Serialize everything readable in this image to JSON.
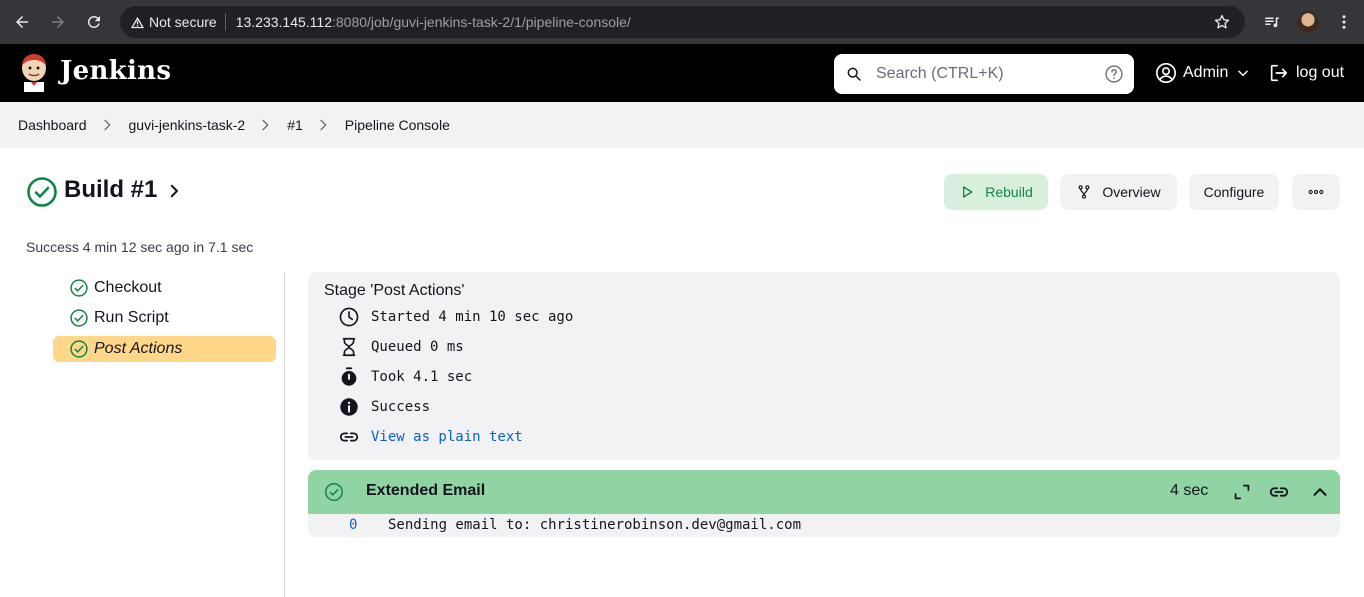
{
  "browser": {
    "security_label": "Not secure",
    "url_host": "13.233.145.112",
    "url_rest": ":8080/job/guvi-jenkins-task-2/1/pipeline-console/"
  },
  "header": {
    "brand": "Jenkins",
    "search_placeholder": "Search (CTRL+K)",
    "user_name": "Admin",
    "logout_label": "log out"
  },
  "breadcrumb": [
    "Dashboard",
    "guvi-jenkins-task-2",
    "#1",
    "Pipeline Console"
  ],
  "build": {
    "title": "Build #1",
    "summary": "Success 4 min 12 sec ago in 7.1 sec",
    "actions": {
      "rebuild": "Rebuild",
      "overview": "Overview",
      "configure": "Configure"
    }
  },
  "stages": [
    {
      "label": "Checkout",
      "status": "success"
    },
    {
      "label": "Run Script",
      "status": "success"
    },
    {
      "label": "Post Actions",
      "status": "success",
      "selected": true
    }
  ],
  "stage_detail": {
    "title": "Stage 'Post Actions'",
    "started": "Started 4 min 10 sec ago",
    "queued": "Queued 0 ms",
    "took": "Took 4.1 sec",
    "status": "Success",
    "plain_text_link": "View as plain text"
  },
  "step": {
    "name": "Extended Email",
    "duration": "4 sec",
    "log_lines": [
      {
        "number": "0",
        "text": "Sending email to: christinerobinson.dev@gmail.com"
      }
    ]
  },
  "colors": {
    "success_green": "#138347",
    "step_header_bg": "#8fd4a2",
    "selected_stage_bg": "#fed888",
    "link_blue": "#0b63c9"
  }
}
